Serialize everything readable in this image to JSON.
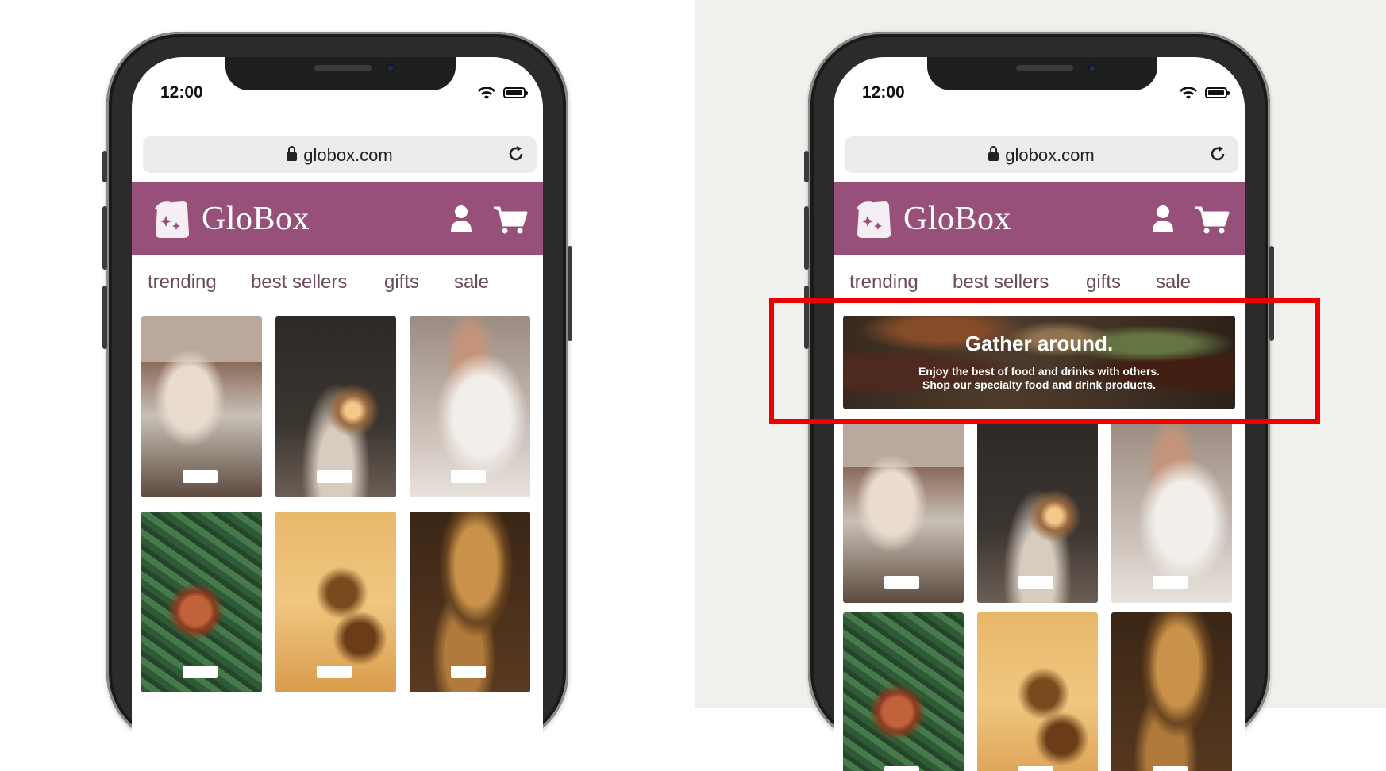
{
  "status": {
    "time": "12:00"
  },
  "browser": {
    "url": "globox.com"
  },
  "header": {
    "brand": "GloBox"
  },
  "nav": {
    "tabs": [
      "trending",
      "best sellers",
      "gifts",
      "sale"
    ]
  },
  "banner": {
    "title": "Gather around.",
    "subtitle_line1": "Enjoy the best of food and drinks with others.",
    "subtitle_line2": "Shop our specialty food and drink products."
  },
  "colors": {
    "header_bg": "#965079",
    "tab_text": "#6b4b5c",
    "highlight": "#ee0000",
    "right_bg": "#f0f1ec"
  },
  "icons": [
    "lock-icon",
    "reload-icon",
    "logo-icon",
    "user-icon",
    "cart-icon",
    "wifi-icon",
    "battery-icon"
  ]
}
